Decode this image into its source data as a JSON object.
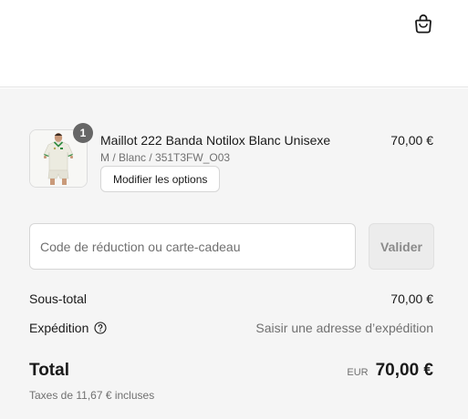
{
  "header": {
    "cart_icon": "shopping-bag-icon"
  },
  "cart": {
    "item": {
      "title": "Maillot 222 Banda Notilox Blanc Unisexe",
      "variant": "M / Blanc / 351T3FW_O03",
      "price": "70,00 €",
      "quantity": "1",
      "modify_label": "Modifier les options"
    },
    "discount": {
      "placeholder": "Code de réduction ou carte-cadeau",
      "value": "",
      "apply_label": "Valider"
    },
    "subtotal": {
      "label": "Sous-total",
      "value": "70,00 €"
    },
    "shipping": {
      "label": "Expédition",
      "value": "Saisir une adresse d’expédition",
      "help_icon": "question-circle-icon"
    },
    "total": {
      "label": "Total",
      "currency": "EUR",
      "value": "70,00 €",
      "taxes": "Taxes de 11,67 € incluses"
    }
  }
}
